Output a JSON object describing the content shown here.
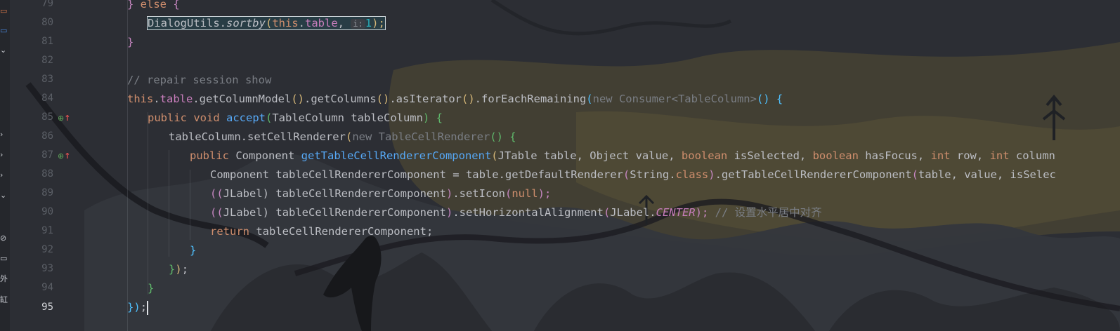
{
  "editor": {
    "current_line": "95",
    "line_numbers": [
      "79",
      "80",
      "81",
      "82",
      "83",
      "84",
      "85",
      "86",
      "87",
      "88",
      "89",
      "90",
      "91",
      "92",
      "93",
      "94",
      "95"
    ],
    "gutter_icons": {
      "line85": "⊕",
      "line87": "⊕",
      "override_mark": "↑"
    },
    "tokens": {
      "l79_a": "} ",
      "l79_else": "else",
      "l79_brace": " {",
      "l80_cls": "DialogUtils.",
      "l80_fn": "sortby",
      "l80_paren": "(",
      "l80_this": "this",
      "l80_dot": ".",
      "l80_table": "table",
      "l80_comma": ", ",
      "l80_hint": "i:",
      "l80_num": "1",
      "l80_close": ");",
      "l81": "}",
      "l83_comment": "// repair session show",
      "l84_this": "this",
      "l84_dot": ".",
      "l84_table": "table",
      "l84_a": ".getColumnModel",
      "l84_p1": "()",
      "l84_b": ".getColumns",
      "l84_p2": "()",
      "l84_c": ".asIterator",
      "l84_p3": "()",
      "l84_d": ".forEachRemaining",
      "l84_p4": "(",
      "l84_new": "new Consumer<TableColumn>",
      "l84_p5": "() {",
      "l85_public": "public",
      "l85_void": " void ",
      "l85_fn": "accept",
      "l85_p": "(",
      "l85_args": "TableColumn tableColumn",
      "l85_close": ") {",
      "l86_a": "tableColumn.setCellRenderer",
      "l86_p": "(",
      "l86_new": "new TableCellRenderer",
      "l86_close": "() {",
      "l87_public": "public",
      "l87_type": " Component ",
      "l87_fn": "getTableCellRendererComponent",
      "l87_p": "(",
      "l87_a": "JTable table, Object value, ",
      "l87_bool1": "boolean",
      "l87_b": " isSelected, ",
      "l87_bool2": "boolean",
      "l87_c": " hasFocus, ",
      "l87_int1": "int",
      "l87_d": " row, ",
      "l87_int2": "int",
      "l87_e": " column",
      "l88_a": "Component tableCellRendererComponent = table.getDefaultRenderer",
      "l88_p": "(",
      "l88_b": "String.",
      "l88_class": "class",
      "l88_c": ")",
      "l88_d": ".getTableCellRendererComponent",
      "l88_p2": "(",
      "l88_e": "table, value, isSelec",
      "l89_p": "((",
      "l89_a": "JLabel",
      "l89_b": ") tableCellRendererComponent",
      "l89_c": ")",
      "l89_d": ".setIcon",
      "l89_e": "(",
      "l89_null": "null",
      "l89_f": ");",
      "l90_p": "((",
      "l90_a": "JLabel",
      "l90_b": ") tableCellRendererComponent",
      "l90_c": ")",
      "l90_d": ".setHorizontalAlignment",
      "l90_e": "(",
      "l90_f": "JLabel.",
      "l90_center": "CENTER",
      "l90_g": ");",
      "l90_comment": " // 设置水平居中对齐",
      "l91_return": "return",
      "l91_a": " tableCellRendererComponent;",
      "l92": "}",
      "l93_a": "}",
      "l93_b": ")",
      "l93_c": ";",
      "l94": "}",
      "l95_a": "}",
      "l95_b": ")",
      "l95_c": ";"
    }
  },
  "sidebar_strip": {
    "icons": [
      "folder-icon",
      "folder-icon",
      "chevron-down-icon",
      "chevron-right-icon",
      "chevron-right-icon",
      "chevron-right-icon",
      "chevron-down-icon",
      "no-entry-icon",
      "terminal-icon"
    ],
    "glyphs": [
      "▭",
      "▭",
      "⌄",
      "›",
      "›",
      "›",
      "⌄",
      "⊘",
      "▭"
    ],
    "text_fragments": [
      "外",
      "缸"
    ]
  },
  "colors": {
    "background": "#2b2d33",
    "keyword": "#cf8e6d",
    "method": "#56a8f5",
    "comment": "#7a7e85",
    "field": "#c77dbb",
    "number": "#2aacb8"
  }
}
